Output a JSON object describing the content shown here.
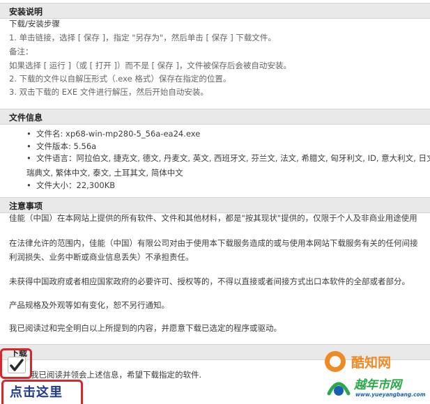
{
  "install": {
    "title": "安装说明",
    "lines": [
      "下载/安装步骤",
      "1. 单击链接，选择 [ 保存 ]，指定 \"另存为\"，然后单击 [ 保存 ] 下载文件。",
      "备注：",
      "如果选择 [ 运行 ]（或 [ 打开 ]）而不是 [ 保存 ]，文件被保存后会被自动安装。",
      "2. 下载的文件以自解压形式（.exe 格式）保存在指定的位置。",
      "3. 双击下载的 EXE 文件进行解压，然后开始自动安装。"
    ]
  },
  "fileinfo": {
    "title": "文件信息",
    "name": "文件名: xp68-win-mp280-5_56a-ea24.exe",
    "version": "文件版本: 5.56a",
    "language_line1": "文件语言：阿拉伯文, 捷克文, 德文, 丹麦文, 英文, 西班牙文, 芬兰文, 法文, 希腊文, 匈牙利文, ID, 意大利文, 日文",
    "language_line2": "瑞典文, 繁体中文, 泰文, 土耳其文, 简体中文",
    "size": "文件大小：22,300KB"
  },
  "notes": {
    "title": "注意事项",
    "p1": "佳能（中国）在本网站上提供的所有软件、文件和其他材料，都是\"按其现状\"提供的，仅限于个人及非商业用途使用",
    "p2a": "在法律允许的范围内，佳能（中国）有限公司对由于使用本下载服务造成的或与使用本网站下载服务有关的任何间接",
    "p2b": "利润损失、业务中断或商业信息丢失）不承担责任。",
    "p3": "未获得中国政府或者相应国家政府的必要许可、授权等的，不得以直接或者间接方式出口本软件的全部或者部分。",
    "p4": "产品规格及外观等如有变化，恕不另行通知。",
    "p5": "我已阅读过和完全明白以上所提到的内容，并愿意下载已选定的程序或驱动。"
  },
  "download": {
    "title": "下载",
    "agree_text": "我已阅读并领会上述信息，希望下载指定的软件.",
    "agree_checked": true,
    "link_label": "点击这里"
  },
  "watermark": {
    "brand1": "酷知网",
    "brand2": "越年市网",
    "url": "www.yueyangbang.com"
  },
  "colors": {
    "highlight": "#d8262b",
    "link": "#1f3a8f",
    "watermark_orange": "#f08a24",
    "watermark_green": "#2aa84a",
    "watermark_blue": "#1a5fb4"
  }
}
